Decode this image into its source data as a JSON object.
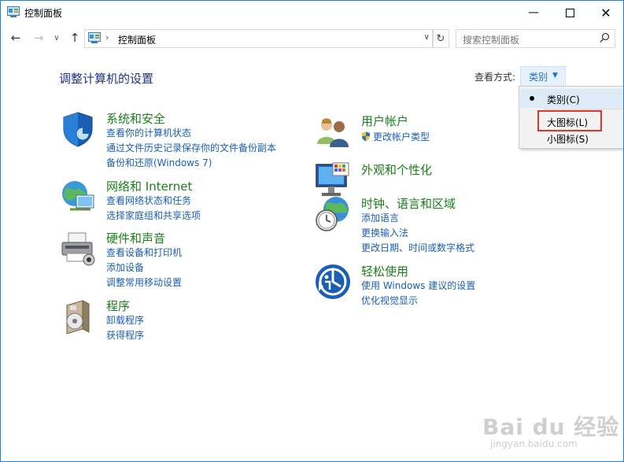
{
  "window": {
    "title": "控制面板"
  },
  "address": {
    "path": "控制面板",
    "search_placeholder": "搜索控制面板"
  },
  "heading": "调整计算机的设置",
  "view_by": {
    "label": "查看方式:",
    "selected": "类别",
    "options": [
      "类别(C)",
      "大图标(L)",
      "小图标(S)"
    ]
  },
  "categories": {
    "system": {
      "title": "系统和安全",
      "links": [
        "查看你的计算机状态",
        "通过文件历史记录保存你的文件备份副本",
        "备份和还原(Windows 7)"
      ]
    },
    "network": {
      "title": "网络和 Internet",
      "links": [
        "查看网络状态和任务",
        "选择家庭组和共享选项"
      ]
    },
    "hardware": {
      "title": "硬件和声音",
      "links": [
        "查看设备和打印机",
        "添加设备",
        "调整常用移动设置"
      ]
    },
    "programs": {
      "title": "程序",
      "links": [
        "卸载程序",
        "获得程序"
      ]
    },
    "users": {
      "title": "用户帐户",
      "links": [
        "更改帐户类型"
      ]
    },
    "appearance": {
      "title": "外观和个性化",
      "links": []
    },
    "clock": {
      "title": "时钟、语言和区域",
      "links": [
        "添加语言",
        "更换输入法",
        "更改日期、时间或数字格式"
      ]
    },
    "ease": {
      "title": "轻松使用",
      "links": [
        "使用 Windows 建议的设置",
        "优化视觉显示"
      ]
    }
  },
  "watermark": {
    "main": "Bai du 经验",
    "sub": "jingyan.baidu.com"
  },
  "colors": {
    "accent": "#1883d7",
    "category_title": "#1b7f1b",
    "link": "#1a5fb4",
    "highlight_box": "#e0352b"
  }
}
